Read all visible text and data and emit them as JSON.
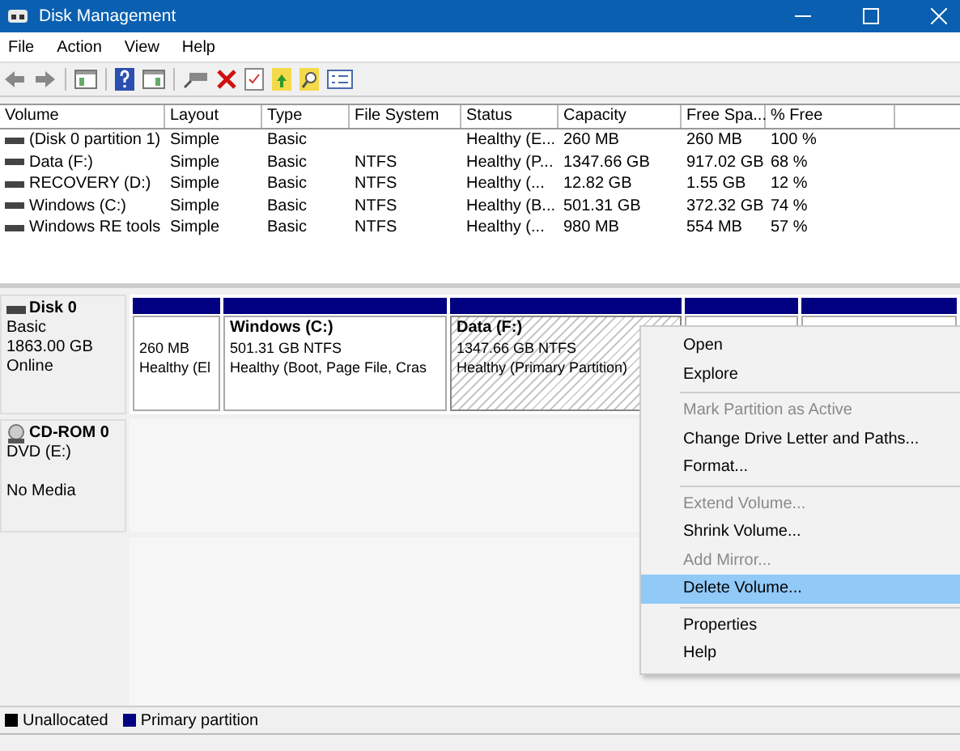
{
  "window": {
    "title": "Disk Management"
  },
  "menu": [
    "File",
    "Action",
    "View",
    "Help"
  ],
  "table": {
    "columns": [
      "Volume",
      "Layout",
      "Type",
      "File System",
      "Status",
      "Capacity",
      "Free Spa...",
      "% Free"
    ],
    "rows": [
      [
        "(Disk 0 partition 1)",
        "Simple",
        "Basic",
        "",
        "Healthy (E...",
        "260 MB",
        "260 MB",
        "100 %"
      ],
      [
        "Data (F:)",
        "Simple",
        "Basic",
        "NTFS",
        "Healthy (P...",
        "1347.66 GB",
        "917.02 GB",
        "68 %"
      ],
      [
        "RECOVERY (D:)",
        "Simple",
        "Basic",
        "NTFS",
        "Healthy (...",
        "12.82 GB",
        "1.55 GB",
        "12 %"
      ],
      [
        "Windows (C:)",
        "Simple",
        "Basic",
        "NTFS",
        "Healthy (B...",
        "501.31 GB",
        "372.32 GB",
        "74 %"
      ],
      [
        "Windows RE tools",
        "Simple",
        "Basic",
        "NTFS",
        "Healthy (...",
        "980 MB",
        "554 MB",
        "57 %"
      ]
    ]
  },
  "disks": [
    {
      "kind": "disk",
      "name": "Disk 0",
      "lines": [
        "Basic",
        "1863.00 GB",
        "Online"
      ],
      "partitions": [
        {
          "lines": [
            "260 MB",
            "Healthy (El"
          ],
          "selected": false
        },
        {
          "title": "Windows  (C:)",
          "lines": [
            "501.31 GB NTFS",
            "Healthy (Boot, Page File, Cras"
          ],
          "selected": false
        },
        {
          "title": "Data  (F:)",
          "lines": [
            "1347.66 GB NTFS",
            "Healthy (Primary Partition)"
          ],
          "selected": true
        },
        {
          "selected": false
        },
        {
          "selected": false
        }
      ]
    },
    {
      "kind": "cdrom",
      "name": "CD-ROM 0",
      "lines": [
        "DVD (E:)"
      ],
      "status": "No Media"
    }
  ],
  "context_menu": [
    [
      {
        "label": "Open",
        "disabled": false,
        "selected": false
      },
      {
        "label": "Explore",
        "disabled": false,
        "selected": false
      }
    ],
    [
      {
        "label": "Mark Partition as Active",
        "disabled": true,
        "selected": false
      },
      {
        "label": "Change Drive Letter and Paths...",
        "disabled": false,
        "selected": false
      },
      {
        "label": "Format...",
        "disabled": false,
        "selected": false
      }
    ],
    [
      {
        "label": "Extend Volume...",
        "disabled": true,
        "selected": false
      },
      {
        "label": "Shrink Volume...",
        "disabled": false,
        "selected": false
      },
      {
        "label": "Add Mirror...",
        "disabled": true,
        "selected": false
      },
      {
        "label": "Delete Volume...",
        "disabled": false,
        "selected": true
      }
    ],
    [
      {
        "label": "Properties",
        "disabled": false,
        "selected": false
      },
      {
        "label": "Help",
        "disabled": false,
        "selected": false
      }
    ]
  ],
  "legend": [
    {
      "label": "Unallocated",
      "color": "#000000"
    },
    {
      "label": "Primary partition",
      "color": "#000080"
    }
  ]
}
